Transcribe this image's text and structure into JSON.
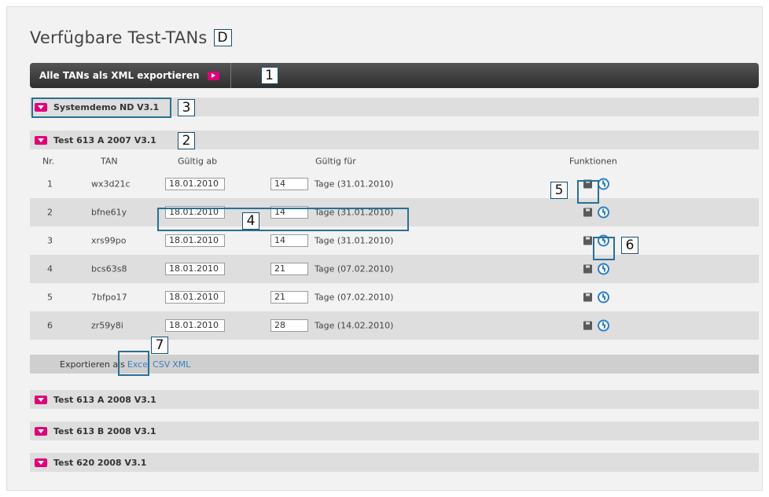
{
  "page": {
    "title": "Verfügbare Test-TANs",
    "title_callout": "D"
  },
  "toolbar": {
    "export_all_label": "Alle TANs als XML exportieren",
    "callout": "1"
  },
  "groups_top": [
    {
      "label": "Systemdemo ND V3.1",
      "callout": "3"
    },
    {
      "label": "Test 613 A 2007 V3.1",
      "callout": "2"
    }
  ],
  "table": {
    "headers": {
      "nr": "Nr.",
      "tan": "TAN",
      "gueltig_ab": "Gültig ab",
      "gueltig_fuer": "Gültig für",
      "funktionen": "Funktionen"
    },
    "rows": [
      {
        "nr": "1",
        "tan": "wx3d21c",
        "date": "18.01.2010",
        "days": "14",
        "until": "Tage (31.01.2010)"
      },
      {
        "nr": "2",
        "tan": "bfne61y",
        "date": "18.01.2010",
        "days": "14",
        "until": "Tage (31.01.2010)"
      },
      {
        "nr": "3",
        "tan": "xrs99po",
        "date": "18.01.2010",
        "days": "14",
        "until": "Tage (31.01.2010)"
      },
      {
        "nr": "4",
        "tan": "bcs63s8",
        "date": "18.01.2010",
        "days": "21",
        "until": "Tage (07.02.2010)"
      },
      {
        "nr": "5",
        "tan": "7bfpo17",
        "date": "18.01.2010",
        "days": "21",
        "until": "Tage (07.02.2010)"
      },
      {
        "nr": "6",
        "tan": "zr59y8i",
        "date": "18.01.2010",
        "days": "28",
        "until": "Tage (14.02.2010)"
      }
    ],
    "callouts": {
      "inputs": "4",
      "save": "5",
      "renew": "6"
    }
  },
  "export_as": {
    "label": "Exportieren als",
    "excel": "Excel",
    "csv": "CSV",
    "xml": "XML",
    "callout": "7"
  },
  "groups_bottom": [
    {
      "label": "Test 613 A 2008 V3.1"
    },
    {
      "label": "Test 613 B 2008 V3.1"
    },
    {
      "label": "Test 620 2008 V3.1"
    }
  ],
  "colors": {
    "accent": "#e0007a",
    "link": "#3a7fc1",
    "callout_border": "#2a6f93"
  },
  "icons": {
    "toggle": "chevron-down-icon",
    "save": "save-icon",
    "renew": "clock-icon",
    "export_arrow": "chevron-right-icon"
  }
}
